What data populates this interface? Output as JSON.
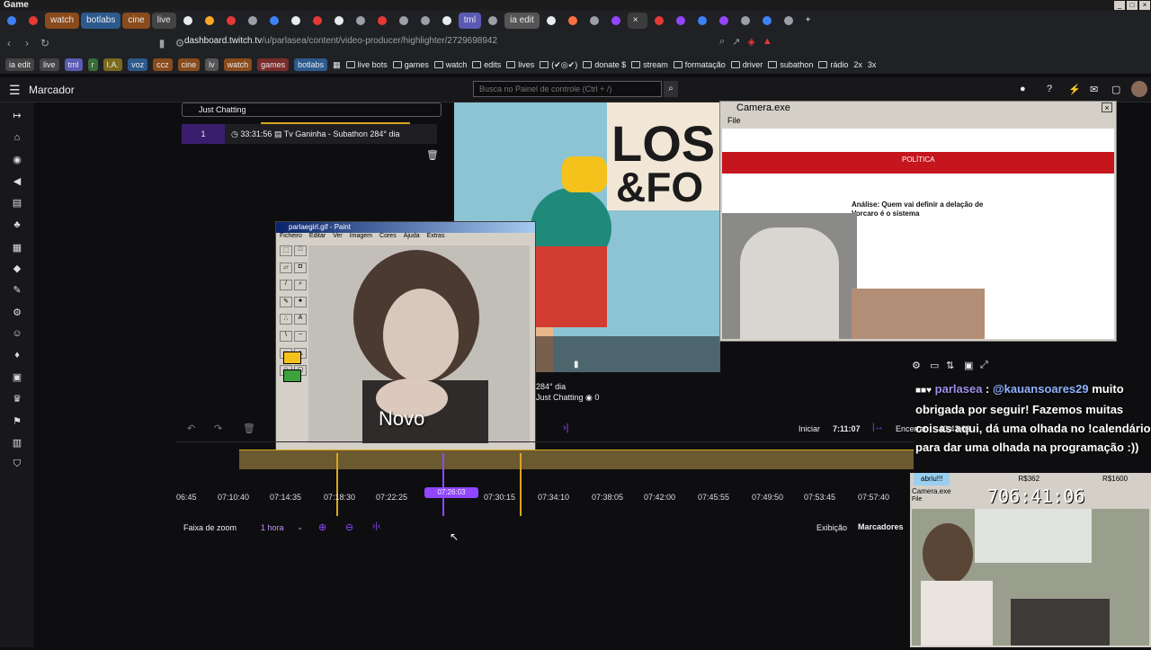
{
  "titlebar": {
    "title": "Game"
  },
  "tabs": [
    {
      "label": "watch",
      "color": "#8a4b1c"
    },
    {
      "label": "botlabs",
      "color": "#2c5a8c"
    },
    {
      "label": "cine",
      "color": "#8a4b1c"
    },
    {
      "label": "live",
      "color": "#444"
    },
    {
      "label": "tml",
      "color": "#5a5ab5"
    },
    {
      "label": "ia edit",
      "color": "#555"
    }
  ],
  "url": {
    "host": "dashboard.twitch.tv",
    "path": "/u/parlasea/content/video-producer/highlighter/2729698942"
  },
  "bookmarks": {
    "chips": [
      "ia edit",
      "live",
      "tml",
      "r",
      "I.A.",
      "voz",
      "ccz",
      "cine",
      "lv",
      "watch",
      "games",
      "botlabs"
    ],
    "folders": [
      "live bots",
      "games",
      "watch",
      "edits",
      "lives",
      "(✔◎✔)",
      "donate $",
      "stream",
      "formatação",
      "driver",
      "subathon",
      "rádio",
      "2x",
      "3x"
    ]
  },
  "header": {
    "section_title": "Marcador",
    "search_placeholder": "Busca no Painel de controle (Ctrl + /)"
  },
  "clip_panel": {
    "category": "Just Chatting",
    "row_number": "1",
    "row_time": "33:31:56",
    "row_title": "Tv Ganinha - Subathon 284° dia"
  },
  "video_info": {
    "title": "284° dia",
    "category": "Just Chatting",
    "viewers": "0"
  },
  "camera_window": {
    "title": "Camera.exe",
    "menu_file": "File",
    "article_heading": "Análise: Quem vai definir a delação de Vorcaro é o sistema",
    "article_section": "POLÍTICA"
  },
  "paint_window": {
    "title": "parlaegirl.gif - Paint",
    "menu": [
      "Ficheiro",
      "Editar",
      "Ver",
      "Imagem",
      "Cores",
      "Ajuda",
      "Extras"
    ],
    "caption": "Novo"
  },
  "chat": {
    "user": "parlasea",
    "mention": "@kauansoares29",
    "message": "muito obrigada por seguir! Fazemos muitas coisas aqui, dá uma olhada no !calendário para dar uma olhada na programação :))"
  },
  "timeline": {
    "start_label": "Iniciar",
    "start_time": "7:11:07",
    "end_label": "Encerrar",
    "end_time": "40:43:03",
    "playhead": "07:26:03",
    "ticks": [
      "06:45",
      "07:10:40",
      "07:14:35",
      "07:18:30",
      "07:22:25",
      "07:30:15",
      "07:34:10",
      "07:38:05",
      "07:42:00",
      "07:45:55",
      "07:49:50",
      "07:53:45",
      "07:57:40"
    ],
    "zoom_label": "Faixa de zoom",
    "zoom_value": "1 hora",
    "view_label": "Exibição",
    "markers_label": "Marcadores"
  },
  "overlay": {
    "tag": "abriu!!!",
    "r1": "R$362",
    "r2": "R$1600",
    "camera_title": "Camera.exe",
    "menu_file": "File",
    "counter": "706:41:06"
  }
}
